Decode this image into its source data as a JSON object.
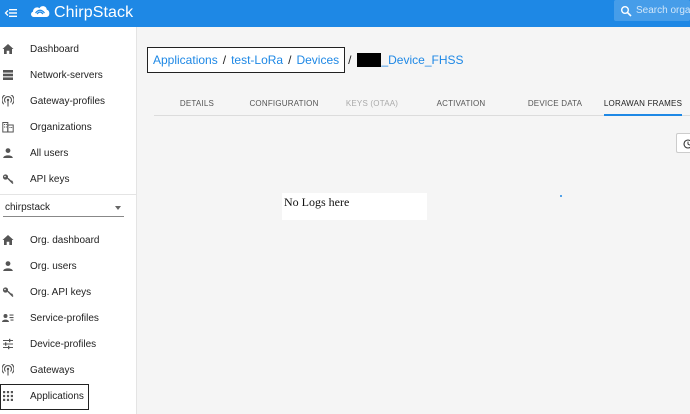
{
  "app": {
    "name": "ChirpStack"
  },
  "search": {
    "placeholder": "Search organization..."
  },
  "sidebar": {
    "global_items": [
      {
        "label": "Dashboard",
        "icon": "home-icon"
      },
      {
        "label": "Network-servers",
        "icon": "server-icon"
      },
      {
        "label": "Gateway-profiles",
        "icon": "radio-tower-icon"
      },
      {
        "label": "Organizations",
        "icon": "domain-icon"
      },
      {
        "label": "All users",
        "icon": "user-icon"
      },
      {
        "label": "API keys",
        "icon": "key-icon"
      }
    ],
    "organization_select": {
      "value": "chirpstack"
    },
    "org_items": [
      {
        "label": "Org. dashboard",
        "icon": "home-icon"
      },
      {
        "label": "Org. users",
        "icon": "user-icon"
      },
      {
        "label": "Org. API keys",
        "icon": "key-icon"
      },
      {
        "label": "Service-profiles",
        "icon": "account-details-icon"
      },
      {
        "label": "Device-profiles",
        "icon": "tune-icon"
      },
      {
        "label": "Gateways",
        "icon": "radio-tower-icon"
      },
      {
        "label": "Applications",
        "icon": "apps-grid-icon"
      }
    ]
  },
  "breadcrumb": {
    "applications": "Applications",
    "application": "test-LoRa",
    "devices": "Devices",
    "separator": "/",
    "device": "_Device_FHSS"
  },
  "tabs": [
    {
      "label": "DETAILS",
      "state": "normal"
    },
    {
      "label": "CONFIGURATION",
      "state": "normal"
    },
    {
      "label": "KEYS (OTAA)",
      "state": "disabled"
    },
    {
      "label": "ACTIVATION",
      "state": "normal"
    },
    {
      "label": "DEVICE DATA",
      "state": "normal"
    },
    {
      "label": "LORAWAN FRAMES",
      "state": "active"
    }
  ],
  "frames": {
    "empty_message": "No Logs here"
  },
  "colors": {
    "primary": "#1e88e5",
    "content_bg": "#f5f5f5",
    "sidebar_bg": "#ffffff"
  }
}
